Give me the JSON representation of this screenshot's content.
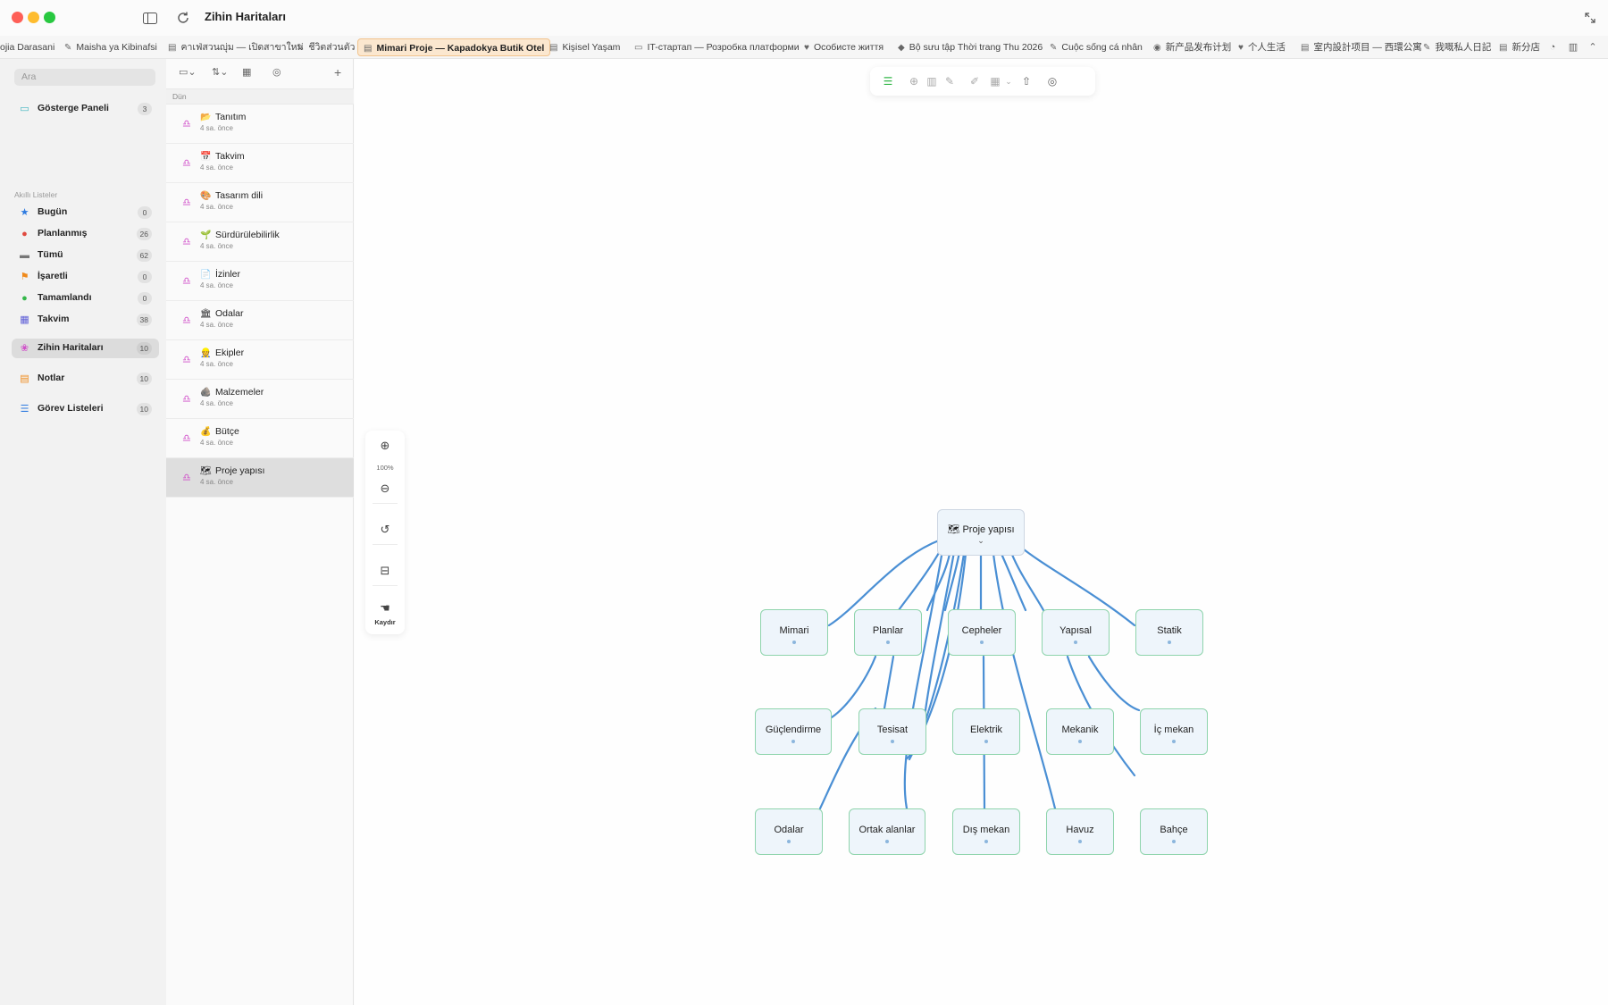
{
  "window": {
    "title": "Zihin Haritaları"
  },
  "tabs": [
    {
      "label": "ojia Darasani",
      "icon": ""
    },
    {
      "label": "Maisha ya Kibinafsi",
      "icon": "✎"
    },
    {
      "label": "คาเฟ่สวนญุ่ม — เปิดสาขาใหม่",
      "icon": "▤"
    },
    {
      "label": "ชีวิตส่วนตัว",
      "icon": "✎"
    },
    {
      "label": "Mimari Proje — Kapadokya Butik Otel",
      "icon": "▤"
    },
    {
      "label": "Kişisel Yaşam",
      "icon": "▤"
    },
    {
      "label": "IT-стартап — Розробка платформи",
      "icon": "▭"
    },
    {
      "label": "Особисте життя",
      "icon": "♥"
    },
    {
      "label": "Bộ sưu tập Thời trang Thu 2026",
      "icon": "◆"
    },
    {
      "label": "Cuộc sống cá nhân",
      "icon": "✎"
    },
    {
      "label": "新产品发布计划",
      "icon": "◉"
    },
    {
      "label": "个人生活",
      "icon": "♥"
    },
    {
      "label": "室内設計项目 — 西環公寓",
      "icon": "▤"
    },
    {
      "label": "我嘅私人日記",
      "icon": "✎"
    },
    {
      "label": "新分店",
      "icon": "▤"
    }
  ],
  "sidebar": {
    "search_placeholder": "Ara",
    "dashboard": {
      "label": "Gösterge Paneli",
      "count": "3"
    },
    "section_label": "Akıllı Listeler",
    "items": [
      {
        "label": "Bugün",
        "count": "0",
        "icon": "★",
        "color": "#2e7be0"
      },
      {
        "label": "Planlanmış",
        "count": "26",
        "icon": "●",
        "color": "#e04a3f"
      },
      {
        "label": "Tümü",
        "count": "62",
        "icon": "▬",
        "color": "#777777"
      },
      {
        "label": "İşaretli",
        "count": "0",
        "icon": "⚑",
        "color": "#f08a1a"
      },
      {
        "label": "Tamamlandı",
        "count": "0",
        "icon": "●",
        "color": "#34b74a"
      },
      {
        "label": "Takvim",
        "count": "38",
        "icon": "▦",
        "color": "#5b5bd6"
      }
    ],
    "mindmaps": {
      "label": "Zihin Haritaları",
      "count": "10"
    },
    "notes": {
      "label": "Notlar",
      "count": "10"
    },
    "tasklists": {
      "label": "Görev Listeleri",
      "count": "10"
    }
  },
  "list": {
    "group_header": "Dün",
    "rows": [
      {
        "emoji": "📂",
        "title": "Tanıtım",
        "time": "4 sa. önce"
      },
      {
        "emoji": "📅",
        "title": "Takvim",
        "time": "4 sa. önce"
      },
      {
        "emoji": "🎨",
        "title": "Tasarım dili",
        "time": "4 sa. önce"
      },
      {
        "emoji": "🌱",
        "title": "Sürdürülebilirlik",
        "time": "4 sa. önce"
      },
      {
        "emoji": "📄",
        "title": "İzinler",
        "time": "4 sa. önce"
      },
      {
        "emoji": "🏛",
        "title": "Odalar",
        "time": "4 sa. önce"
      },
      {
        "emoji": "👷",
        "title": "Ekipler",
        "time": "4 sa. önce"
      },
      {
        "emoji": "🪨",
        "title": "Malzemeler",
        "time": "4 sa. önce"
      },
      {
        "emoji": "💰",
        "title": "Bütçe",
        "time": "4 sa. önce"
      },
      {
        "emoji": "🗺",
        "title": "Proje yapısı",
        "time": "4 sa. önce"
      }
    ]
  },
  "zoom": {
    "level": "100%",
    "pan_label": "Kaydır"
  },
  "mindmap": {
    "root": {
      "emoji": "🗺",
      "label": "Proje yapısı"
    },
    "nodes": [
      "Mimari",
      "Planlar",
      "Cepheler",
      "Yapısal",
      "Statik",
      "Güçlendirme",
      "Tesisat",
      "Elektrik",
      "Mekanik",
      "İç mekan",
      "Odalar",
      "Ortak alanlar",
      "Dış mekan",
      "Havuz",
      "Bahçe"
    ]
  },
  "colors": {
    "accent": "#4a8fd4",
    "node_border": "#8ed4ac",
    "node_fill": "#eef5fb",
    "mindmap_icon": "#d04fc9"
  }
}
